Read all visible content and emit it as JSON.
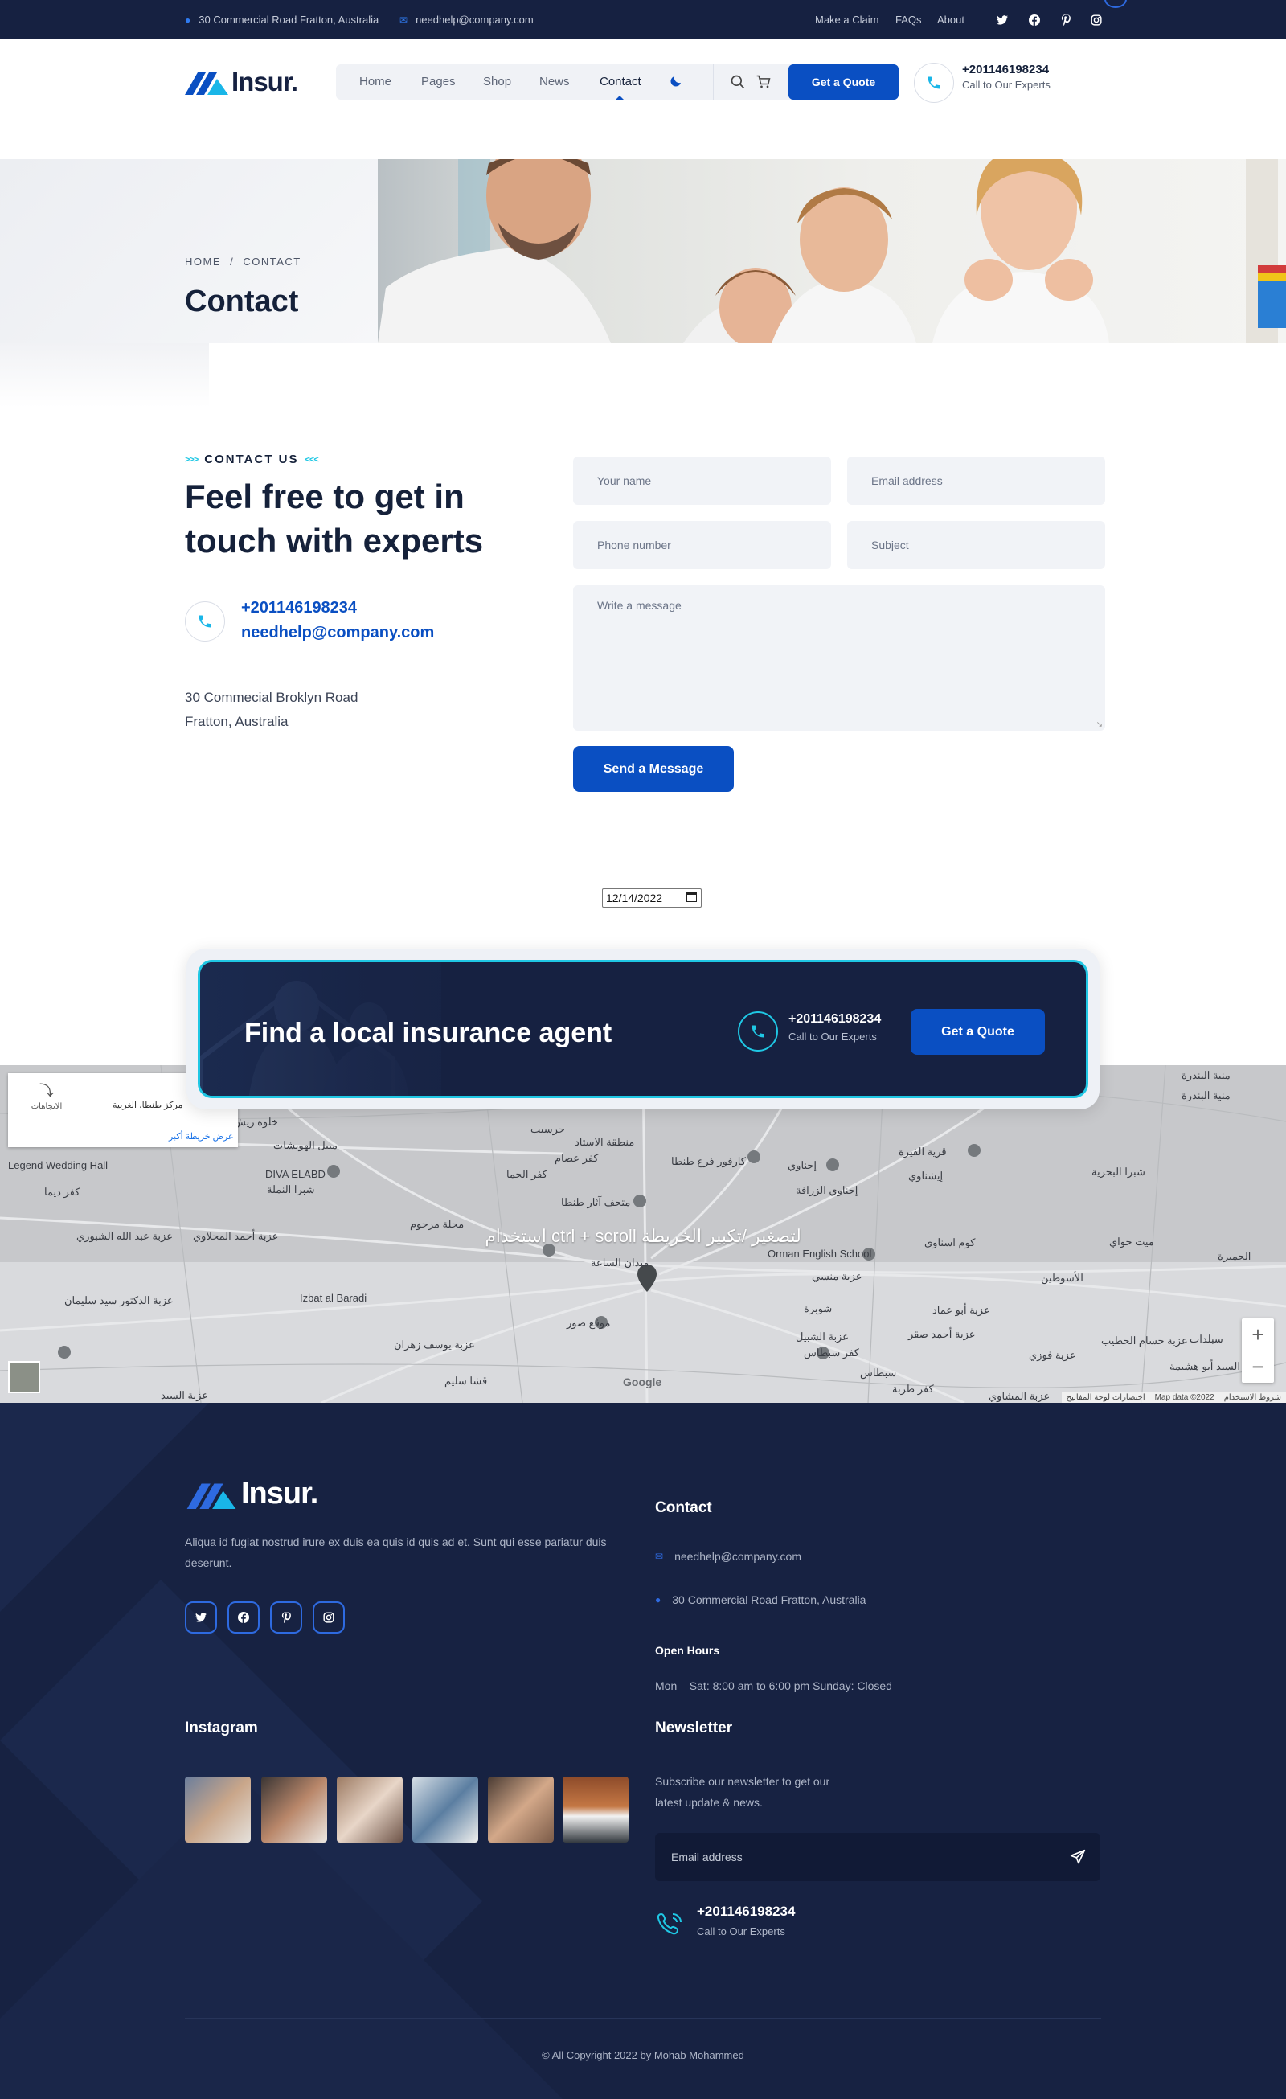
{
  "topbar": {
    "address": "30 Commercial Road Fratton, Australia",
    "email": "needhelp@company.com",
    "links": [
      "Make a Claim",
      "FAQs",
      "About"
    ],
    "social": [
      "twitter-icon",
      "facebook-icon",
      "pinterest-icon",
      "instagram-icon"
    ]
  },
  "header": {
    "logo": "Insur.",
    "nav": [
      "Home",
      "Pages",
      "Shop",
      "News",
      "Contact"
    ],
    "active": "Contact",
    "quote_button": "Get a Quote",
    "phone": "+201146198234",
    "phone_caption": "Call to Our Experts"
  },
  "hero": {
    "breadcrumb_home": "HOME",
    "breadcrumb_sep": "/",
    "breadcrumb_current": "CONTACT",
    "title": "Contact"
  },
  "contact": {
    "eyebrow": "CONTACT US",
    "heading_line1": "Feel free to get in",
    "heading_line2": "touch with experts",
    "phone": "+201146198234",
    "email": "needhelp@company.com",
    "address_line1": "30 Commecial Broklyn Road",
    "address_line2": "Fratton, Australia",
    "form": {
      "name_placeholder": "Your name",
      "email_placeholder": "Email address",
      "phone_placeholder": "Phone number",
      "subject_placeholder": "Subject",
      "message_placeholder": "Write a message",
      "submit": "Send a Message"
    },
    "date_value": "12/14/2022"
  },
  "cta": {
    "title": "Find a local insurance agent",
    "phone": "+201146198234",
    "phone_caption": "Call to Our Experts",
    "button": "Get a Quote"
  },
  "map": {
    "directions": "الاتجاهات",
    "place_title": "مركز طنطا، الغربية",
    "larger_map": "عرض خريطة أكبر",
    "scroll_hint": "استخدام ctrl + scroll لتصغير /تكبير الخريطة",
    "google": "Google",
    "attribution": "Map data ©2022",
    "terms": "شروط الاستخدام",
    "shortcuts": "اختصارات لوحة المفاتيح",
    "zoom_in": "+",
    "zoom_out": "−",
    "labels": [
      "منية البندرة",
      "حرسيت",
      "منطقة الاستاد",
      "خلوه ريش",
      "مبيل الهويشات",
      "كفر عصام",
      "Legend Wedding Hall",
      "كفر ديما",
      "DIVA ELABD",
      "شبرا النملة",
      "كفر الحما",
      "إحناوي",
      "قرية الفيرة",
      "إيشناوي",
      "إحناوي الزرافة",
      "شبرا البحرية",
      "محلة مرحوم",
      "عزبة عبد الله الشبوري",
      "عزبة أحمد المحلاوي",
      "Orman English School",
      "كوم اسناوي",
      "ميت حواي",
      "الجميرة",
      "الأسوطين",
      "عزبة منسي",
      "شوبرة",
      "عزبة الدكتور سيد سليمان",
      "Izbat al Baradi",
      "موقع صور",
      "عزبة يوسف زهران",
      "قشا سليم",
      "عزبة الشبيل",
      "كفر سبطاس",
      "سبطاس",
      "عزبة أبو عماد",
      "عزبة أحمد صقر",
      "عزبة فوزي",
      "عزبة حسام الخطيب",
      "سبلدات",
      "عزبة السيد أبو هشيمة",
      "عزبة السيد",
      "عزبة المشاوي",
      "كفر طربة",
      "ميدان الساعة",
      "متحف آثار طنطا",
      "كارفور فرع طنطا"
    ]
  },
  "footer": {
    "logo": "Insur.",
    "about": "Aliqua id fugiat nostrud irure ex duis ea quis id quis ad et. Sunt qui esse pariatur duis deserunt.",
    "contact_title": "Contact",
    "email": "needhelp@company.com",
    "address": "30 Commercial Road Fratton, Australia",
    "hours_title": "Open Hours",
    "hours": "Mon – Sat: 8:00 am to 6:00 pm Sunday: Closed",
    "instagram_title": "Instagram",
    "newsletter_title": "Newsletter",
    "newsletter_text_line1": "Subscribe our newsletter to get our",
    "newsletter_text_line2": "latest update & news.",
    "newsletter_placeholder": "Email address",
    "phone": "+201146198234",
    "phone_caption": "Call to Our Experts",
    "copyright": "© All Copyright 2022 by Mohab Mohammed"
  },
  "colors": {
    "navy": "#162141",
    "primary": "#0a4fc2",
    "cyan": "#1fc7e4"
  }
}
